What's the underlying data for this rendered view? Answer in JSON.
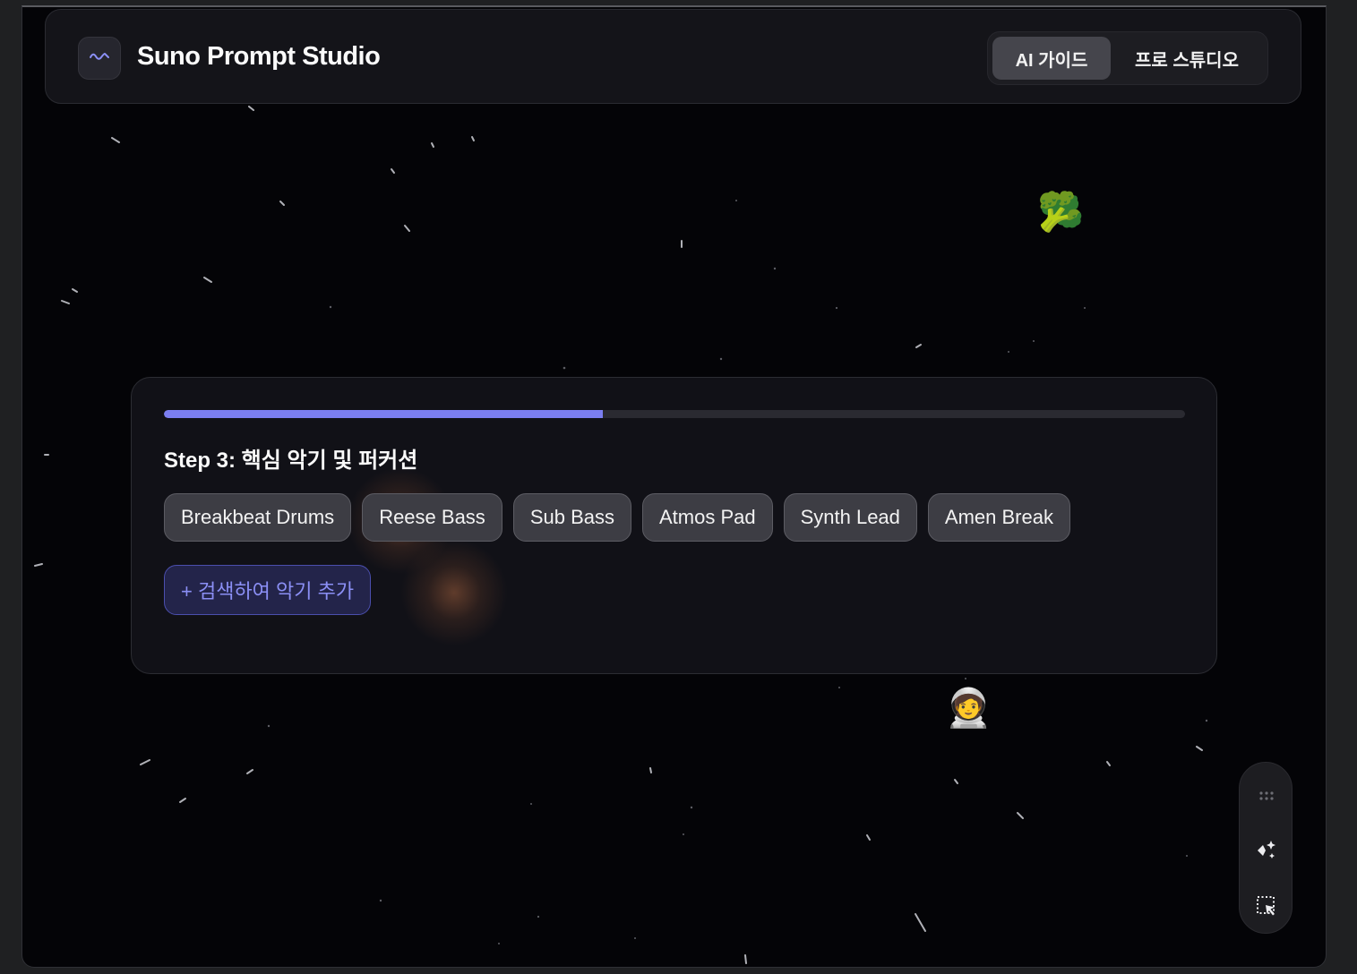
{
  "header": {
    "app_title": "Suno Prompt Studio",
    "logo_icon": "waveform-icon",
    "mode_tabs": [
      {
        "label": "AI 가이드",
        "active": true
      },
      {
        "label": "프로 스튜디오",
        "active": false
      }
    ]
  },
  "wizard": {
    "progress": 0.43,
    "step_title": "Step 3: 핵심 악기 및 퍼커션",
    "instrument_chips": [
      "Breakbeat Drums",
      "Reese Bass",
      "Sub Bass",
      "Atmos Pad",
      "Synth Lead",
      "Amen Break"
    ],
    "add_button_label": "+ 검색하여 악기 추가"
  },
  "decorations": {
    "emoji_broccoli": "🥦",
    "emoji_astronaut": "🧑‍🚀"
  },
  "toolbar": {
    "icons": [
      "drag-handle-icon",
      "sparkle-icon",
      "select-area-icon"
    ]
  },
  "colors": {
    "accent": "#7b7ef0",
    "background": "#040407"
  }
}
